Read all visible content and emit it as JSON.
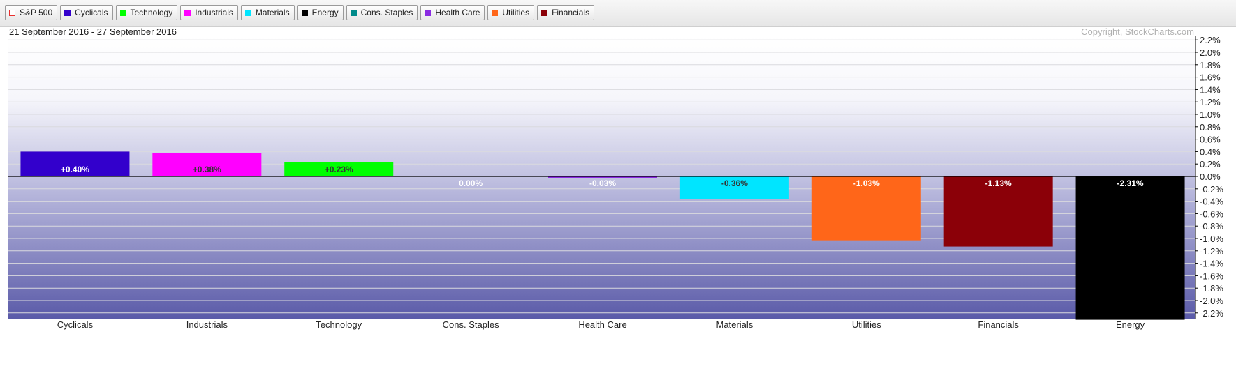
{
  "legend": [
    {
      "label": "S&P 500",
      "color": "#e8302e",
      "outline": true
    },
    {
      "label": "Cyclicals",
      "color": "#3300cc"
    },
    {
      "label": "Technology",
      "color": "#00ff00"
    },
    {
      "label": "Industrials",
      "color": "#ff00ff"
    },
    {
      "label": "Materials",
      "color": "#00e5ff"
    },
    {
      "label": "Energy",
      "color": "#000000"
    },
    {
      "label": "Cons. Staples",
      "color": "#008b8b"
    },
    {
      "label": "Health Care",
      "color": "#8a2be2"
    },
    {
      "label": "Utilities",
      "color": "#ff6619"
    },
    {
      "label": "Financials",
      "color": "#8b0008"
    }
  ],
  "header": {
    "date_range": "21 September 2016 - 27 September 2016",
    "copyright": "Copyright, StockCharts.com"
  },
  "chart_data": {
    "type": "bar",
    "categories": [
      "Cyclicals",
      "Industrials",
      "Technology",
      "Cons. Staples",
      "Health Care",
      "Materials",
      "Utilities",
      "Financials",
      "Energy"
    ],
    "values": [
      0.4,
      0.38,
      0.23,
      0.0,
      -0.03,
      -0.36,
      -1.03,
      -1.13,
      -2.31
    ],
    "value_labels": [
      "+0.40%",
      "+0.38%",
      "+0.23%",
      "0.00%",
      "-0.03%",
      "-0.36%",
      "-1.03%",
      "-1.13%",
      "-2.31%"
    ],
    "colors": [
      "#3300cc",
      "#ff00ff",
      "#00ff00",
      "#008b8b",
      "#8a2be2",
      "#00e5ff",
      "#ff6619",
      "#8b0008",
      "#000000"
    ],
    "label_colors": [
      "#ffffff",
      "#333333",
      "#333333",
      "#ffffff",
      "#ffffff",
      "#333333",
      "#ffffff",
      "#ffffff",
      "#ffffff"
    ],
    "y_ticks": [
      "2.2%",
      "2.0%",
      "1.8%",
      "1.6%",
      "1.4%",
      "1.2%",
      "1.0%",
      "0.8%",
      "0.6%",
      "0.4%",
      "0.2%",
      "0.0%",
      "-0.2%",
      "-0.4%",
      "-0.6%",
      "-0.8%",
      "-1.0%",
      "-1.2%",
      "-1.4%",
      "-1.6%",
      "-1.8%",
      "-2.0%",
      "-2.2%"
    ],
    "ylim": [
      -2.3,
      2.3
    ],
    "grid": true,
    "y_axis_position": "right"
  }
}
